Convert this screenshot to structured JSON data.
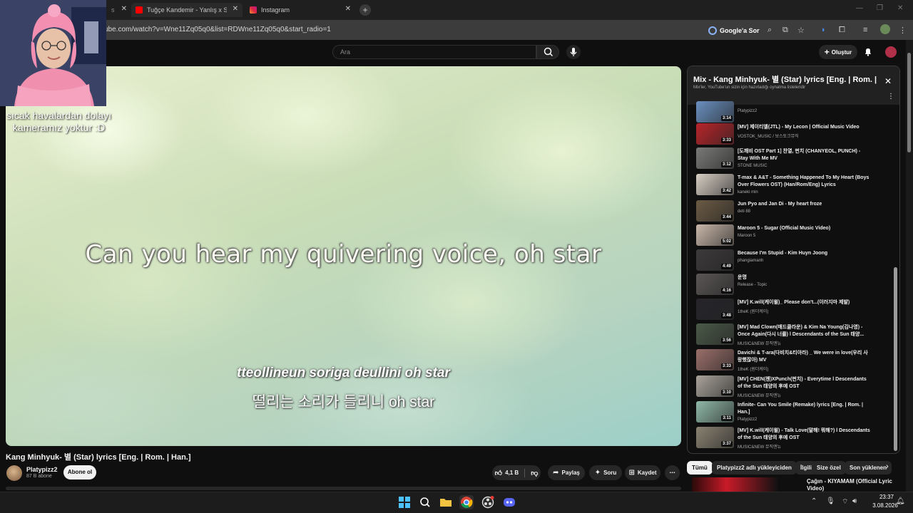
{
  "browser": {
    "tabs": [
      {
        "label": "s",
        "favicon_color": "#ff0000"
      },
      {
        "label": "Tuğçe Kandemir - Yanlış x Simg...",
        "favicon_color": "#ff0000"
      },
      {
        "label": "Instagram",
        "favicon_color": "#e1306c"
      }
    ],
    "url": "ube.com/watch?v=Wne11Zq05q0&list=RDWne11Zq05q0&start_radio=1",
    "google_sor_label": "Google'a Sor"
  },
  "youtube_header": {
    "search_placeholder": "Ara",
    "create_label": "Oluştur"
  },
  "video": {
    "lyric_main": "Can you hear my quivering voice, oh star",
    "lyric_romanized": "tteollineun soriga deullini oh star",
    "lyric_hangul": "떨리는 소리가 들리니 oh star"
  },
  "webcam_overlay": {
    "caption": "sıcak havalardan dolayı kameramız yoktur :D"
  },
  "video_info": {
    "title": "Kang Minhyuk- 별 (Star) lyrics [Eng. | Rom. | Han.]",
    "channel_name": "Platypizz2",
    "subscribers": "87 B abone",
    "subscribe_label": "Abone ol",
    "like_count": "4,1 B",
    "share_label": "Paylaş",
    "ask_label": "Soru",
    "save_label": "Kaydet"
  },
  "playlist": {
    "title": "Mix - Kang Minhyuk- 별 (Star) lyrics [Eng. | Rom. | Han.]",
    "subtitle": "Mix'ler, YouTube'un sizin için hazırladığı oynatma listeleridir",
    "items": [
      {
        "title": "",
        "channel": "Platypizz2",
        "duration": "3:14",
        "color": "#6a90c0"
      },
      {
        "title": "[MV] 제이티엘(JTL) - My Lecon | Official Music Video",
        "channel": "VOSTOK_MUSIC / 보스토크뮤직",
        "duration": "3:33",
        "color": "#b8242a"
      },
      {
        "title": "[도깨비 OST Part 1] 찬열, 펀치 (CHANYEOL, PUNCH) - Stay With Me MV",
        "channel": "STONE MUSIC",
        "duration": "3:12",
        "color": "#7a7a78"
      },
      {
        "title": "T-max & A&T - Something Happened To My Heart (Boys Over Flowers OST) (Han/Rom/Eng) Lyrics",
        "channel": "kaneki min",
        "duration": "3:42",
        "color": "#d8cfc4"
      },
      {
        "title": "Jun Pyo and Jan Di - My heart froze",
        "channel": "deti 88",
        "duration": "3:44",
        "color": "#6b5a44"
      },
      {
        "title": "Maroon 5 - Sugar (Official Music Video)",
        "channel": "Maroon 5",
        "duration": "5:02",
        "color": "#c9b7a9"
      },
      {
        "title": "Because I'm Stupid - Kim Huyn Joong",
        "channel": "phangiamanh",
        "duration": "4:49",
        "color": "#3d3a3c"
      },
      {
        "title": "운명",
        "channel": "Release - Topic",
        "duration": "4:16",
        "color": "#5a5655"
      },
      {
        "title": "[MV] K.will(케이윌)_ Please don't...(이러지마 제발)",
        "channel": "1theK (원더케이)",
        "duration": "3:48",
        "color": "#26242a"
      },
      {
        "title": "[MV] Mad Clown(매드클라운) & Kim Na Young(김나영) - Once Again(다시 너를) l Descendants of the Sun 태양...",
        "channel": "MUSIC&NEW 뮤직앤뉴",
        "duration": "3:56",
        "color": "#4a5a48"
      },
      {
        "title": "Davichi & T-ara(다비치&티아라) _ We were in love(우리 사랑했잖아) MV",
        "channel": "1theK (원더케이)",
        "duration": "3:33",
        "color": "#9b6f6a"
      },
      {
        "title": "[MV] CHEN(첸)XPunch(펀치) - Everytime l Descendants of the Sun 태양의 후예 OST",
        "channel": "MUSIC&NEW 뮤직앤뉴",
        "duration": "3:10",
        "color": "#a9a39a"
      },
      {
        "title": "Infinite- Can You Smile (Remake) lyrics [Eng. | Rom. | Han.]",
        "channel": "Platypizz2",
        "duration": "3:11",
        "color": "#8fb8a8"
      },
      {
        "title": "[MV] K.will(케이윌) - Talk Love(말해! 뭐해?) l Descendants of the Sun 태양의 후예 OST",
        "channel": "MUSIC&NEW 뮤직앤뉴",
        "duration": "3:37",
        "color": "#8a8272"
      }
    ]
  },
  "chips": [
    "Tümü",
    "Platypizz2 adlı yükleyiciden",
    "İlgili",
    "Size özel",
    "Son yüklenen"
  ],
  "recommendation": {
    "title": "Çağın - KIYAMAM (Official Lyric Video)"
  },
  "taskbar": {
    "time": "23:37",
    "date": "3.08.2026"
  },
  "colors": {
    "background": "#0f0f0f",
    "accent_red": "#ff0000",
    "panel": "#212121"
  }
}
